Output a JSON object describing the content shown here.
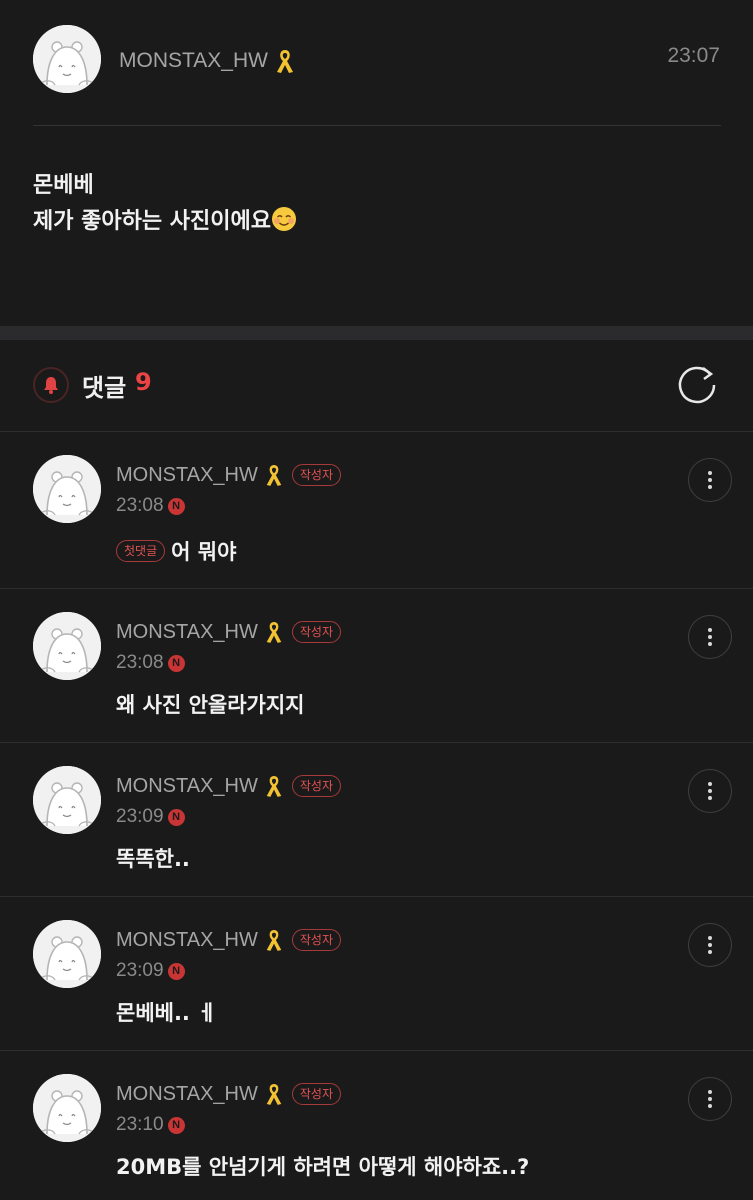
{
  "post": {
    "author": "MONSTAX_HW",
    "time": "23:07",
    "lines": [
      "몬베베",
      "제가 좋아하는 사진이에요"
    ],
    "ribbon_color": "#f2c232"
  },
  "comments_section": {
    "label": "댓글",
    "count": "9",
    "accent_color": "#ec4444"
  },
  "comments": [
    {
      "author": "MONSTAX_HW",
      "badge": "작성자",
      "time": "23:08",
      "new": "N",
      "first_badge": "첫댓글",
      "text": "어 뭐야"
    },
    {
      "author": "MONSTAX_HW",
      "badge": "작성자",
      "time": "23:08",
      "new": "N",
      "text": "왜 사진 안올라가지지"
    },
    {
      "author": "MONSTAX_HW",
      "badge": "작성자",
      "time": "23:09",
      "new": "N",
      "text": "똑똑한.."
    },
    {
      "author": "MONSTAX_HW",
      "badge": "작성자",
      "time": "23:09",
      "new": "N",
      "text": "몬베베.. ㅔ"
    },
    {
      "author": "MONSTAX_HW",
      "badge": "작성자",
      "time": "23:10",
      "new": "N",
      "text": "20MB를 안넘기게 하려면 아떻게 해야하죠..?"
    }
  ]
}
